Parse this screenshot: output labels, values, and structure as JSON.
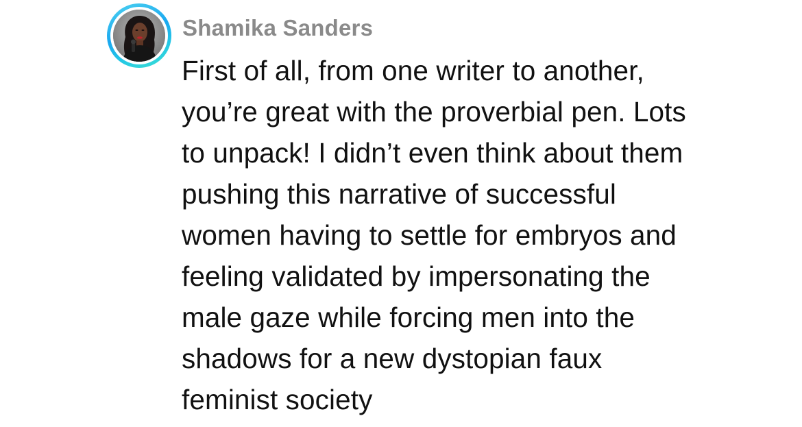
{
  "comment": {
    "username": "Shamika Sanders",
    "avatar_icon": "user-avatar-photo",
    "ring_colors": [
      "#4fd3f0",
      "#1aa8f0",
      "#3de0d2"
    ],
    "body_lines": [
      "First of all, from one writer to another,",
      "you’re great with the proverbial pen. Lots",
      "to unpack! I didn’t even think about them",
      "pushing this narrative of successful",
      "women having to settle for embryos and",
      "feeling validated by impersonating the",
      "male gaze while forcing men into the",
      "shadows for a new dystopian faux",
      "feminist society"
    ]
  }
}
